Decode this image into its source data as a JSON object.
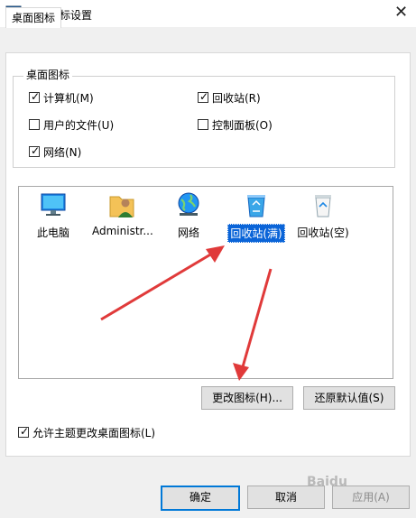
{
  "window": {
    "title": "桌面图标设置",
    "close_glyph": "✕"
  },
  "tabs": [
    {
      "label": "桌面图标",
      "active": true
    }
  ],
  "group": {
    "legend": "桌面图标",
    "checkboxes": [
      {
        "label": "计算机(M)",
        "checked": true
      },
      {
        "label": "回收站(R)",
        "checked": true
      },
      {
        "label": "用户的文件(U)",
        "checked": false
      },
      {
        "label": "控制面板(O)",
        "checked": false
      },
      {
        "label": "网络(N)",
        "checked": true
      }
    ]
  },
  "icons": [
    {
      "label": "此电脑",
      "icon": "computer-icon",
      "selected": false
    },
    {
      "label": "Administr...",
      "icon": "user-folder-icon",
      "selected": false
    },
    {
      "label": "网络",
      "icon": "network-globe-icon",
      "selected": false
    },
    {
      "label": "回收站(满)",
      "icon": "recycle-bin-full-icon",
      "selected": true
    },
    {
      "label": "回收站(空)",
      "icon": "recycle-bin-empty-icon",
      "selected": false
    }
  ],
  "buttons": {
    "change_icon": "更改图标(H)...",
    "restore_default": "还原默认值(S)",
    "ok": "确定",
    "cancel": "取消",
    "apply": "应用(A)"
  },
  "allow_themes": {
    "label": "允许主题更改桌面图标(L)",
    "checked": true
  },
  "watermark": "Baidu",
  "colors": {
    "selection": "#0a64d8",
    "annotation_arrow": "#e03a3a",
    "primary_border": "#0078d7"
  }
}
